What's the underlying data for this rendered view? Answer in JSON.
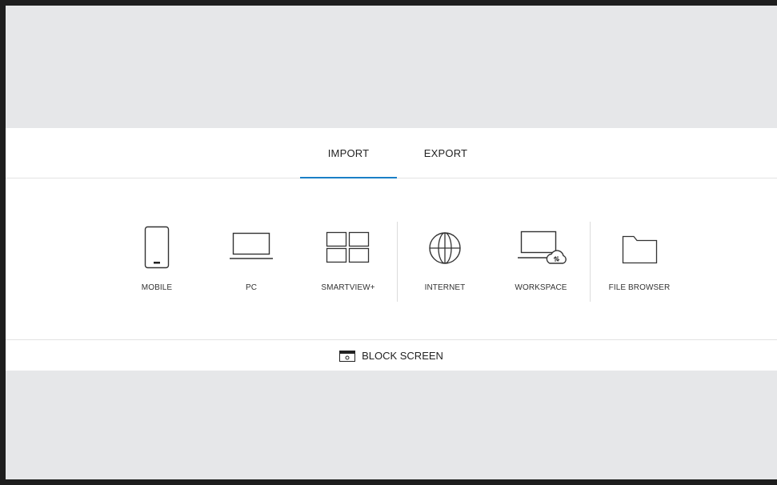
{
  "tabs": [
    {
      "label": "IMPORT",
      "active": true
    },
    {
      "label": "EXPORT",
      "active": false
    }
  ],
  "sources": [
    {
      "label": "MOBILE",
      "icon": "mobile-phone-icon"
    },
    {
      "label": "PC",
      "icon": "laptop-icon"
    },
    {
      "label": "SMARTVIEW+",
      "icon": "grid-four-screens-icon"
    },
    {
      "label": "INTERNET",
      "icon": "globe-icon"
    },
    {
      "label": "WORKSPACE",
      "icon": "laptop-cloud-icon"
    },
    {
      "label": "FILE BROWSER",
      "icon": "folder-icon"
    }
  ],
  "block_screen": {
    "label": "BLOCK SCREEN",
    "icon": "block-screen-icon"
  },
  "colors": {
    "accent": "#1a7fc6",
    "backdrop": "#e6e7e9",
    "frame": "#1e1e1e"
  }
}
